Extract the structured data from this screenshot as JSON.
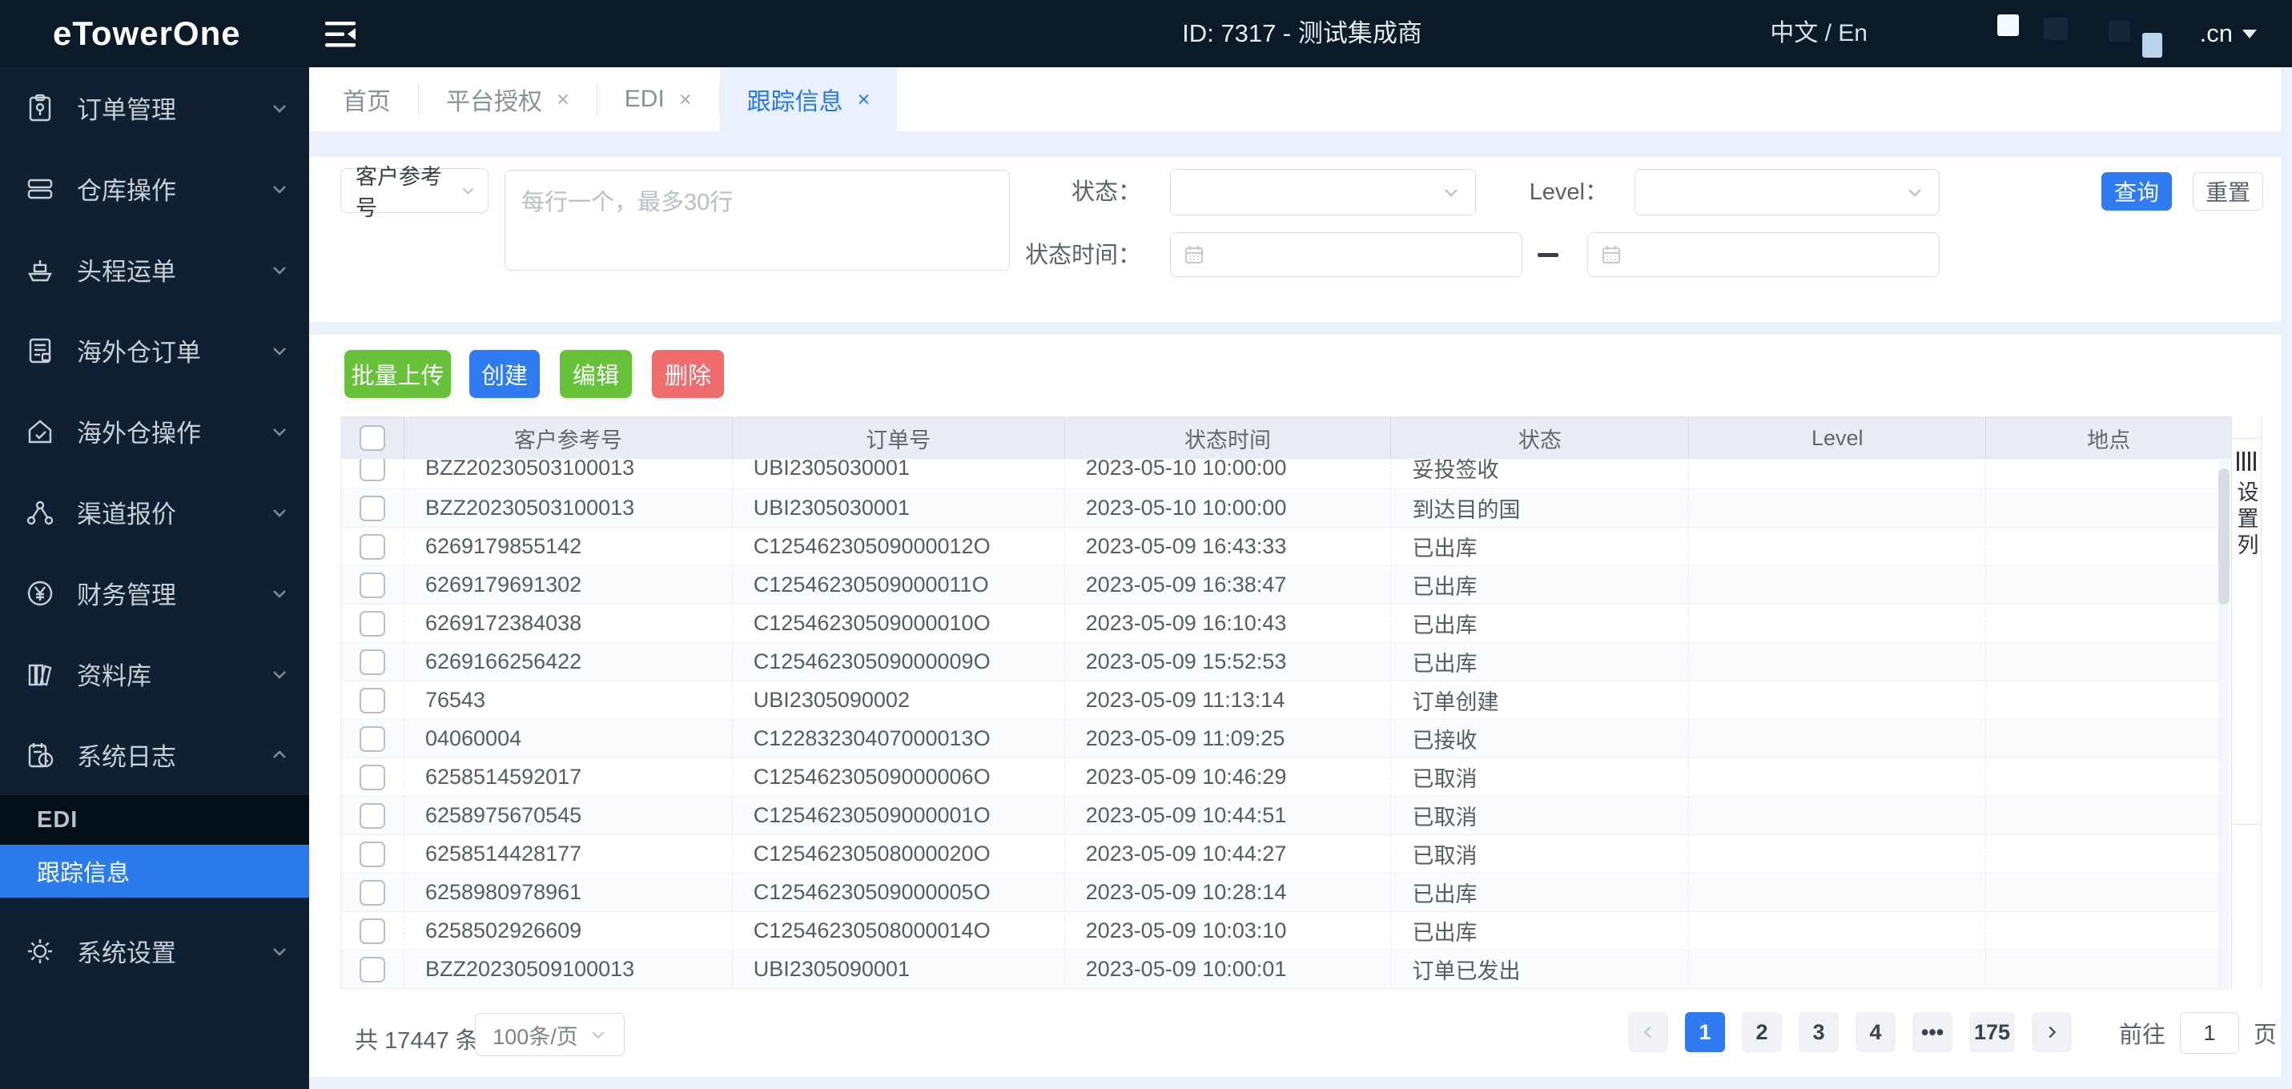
{
  "header": {
    "logo": "eTowerOne",
    "title": "ID: 7317 - 测试集成商",
    "language": "中文 / En",
    "domain": ".cn"
  },
  "sidebar": {
    "items": [
      {
        "label": "订单管理",
        "icon": "clipboard-icon"
      },
      {
        "label": "仓库操作",
        "icon": "boxes-icon"
      },
      {
        "label": "头程运单",
        "icon": "ship-icon"
      },
      {
        "label": "海外仓订单",
        "icon": "document-icon"
      },
      {
        "label": "海外仓操作",
        "icon": "house-check-icon"
      },
      {
        "label": "渠道报价",
        "icon": "share-nodes-icon"
      },
      {
        "label": "财务管理",
        "icon": "yen-circle-icon"
      },
      {
        "label": "资料库",
        "icon": "library-icon"
      },
      {
        "label": "系统日志",
        "icon": "clipboard-clock-icon",
        "expanded": true
      },
      {
        "label": "系统设置",
        "icon": "gear-icon"
      }
    ],
    "submenu": {
      "edi": "EDI",
      "tracking": "跟踪信息"
    }
  },
  "tabs": {
    "home": "首页",
    "platform": "平台授权",
    "edi": "EDI",
    "tracking": "跟踪信息",
    "close_glyph": "×"
  },
  "filters": {
    "field_select_value": "客户参考号",
    "textarea_placeholder": "每行一个，最多30行",
    "status_label": "状态：",
    "level_label": "Level：",
    "time_label": "状态时间：",
    "query_button": "查询",
    "reset_button": "重置"
  },
  "toolbar": {
    "bulk_upload": "批量上传",
    "create": "创建",
    "edit": "编辑",
    "delete": "删除"
  },
  "table": {
    "columns": [
      "客户参考号",
      "订单号",
      "状态时间",
      "状态",
      "Level",
      "地点"
    ],
    "settings_label": "设置列",
    "rows": [
      {
        "ref": "BZZ20230503100013",
        "order": "UBI2305030001",
        "time": "2023-05-10 10:00:00",
        "status": "妥投签收",
        "level": "",
        "location": ""
      },
      {
        "ref": "BZZ20230503100013",
        "order": "UBI2305030001",
        "time": "2023-05-10 10:00:00",
        "status": "到达目的国",
        "level": "",
        "location": ""
      },
      {
        "ref": "6269179855142",
        "order": "C12546230509000012O",
        "time": "2023-05-09 16:43:33",
        "status": "已出库",
        "level": "",
        "location": ""
      },
      {
        "ref": "6269179691302",
        "order": "C12546230509000011O",
        "time": "2023-05-09 16:38:47",
        "status": "已出库",
        "level": "",
        "location": ""
      },
      {
        "ref": "6269172384038",
        "order": "C12546230509000010O",
        "time": "2023-05-09 16:10:43",
        "status": "已出库",
        "level": "",
        "location": ""
      },
      {
        "ref": "6269166256422",
        "order": "C12546230509000009O",
        "time": "2023-05-09 15:52:53",
        "status": "已出库",
        "level": "",
        "location": ""
      },
      {
        "ref": "76543",
        "order": "UBI2305090002",
        "time": "2023-05-09 11:13:14",
        "status": "订单创建",
        "level": "",
        "location": ""
      },
      {
        "ref": "04060004",
        "order": "C12283230407000013O",
        "time": "2023-05-09 11:09:25",
        "status": "已接收",
        "level": "",
        "location": ""
      },
      {
        "ref": "6258514592017",
        "order": "C12546230509000006O",
        "time": "2023-05-09 10:46:29",
        "status": "已取消",
        "level": "",
        "location": ""
      },
      {
        "ref": "6258975670545",
        "order": "C12546230509000001O",
        "time": "2023-05-09 10:44:51",
        "status": "已取消",
        "level": "",
        "location": ""
      },
      {
        "ref": "6258514428177",
        "order": "C12546230508000020O",
        "time": "2023-05-09 10:44:27",
        "status": "已取消",
        "level": "",
        "location": ""
      },
      {
        "ref": "6258980978961",
        "order": "C12546230509000005O",
        "time": "2023-05-09 10:28:14",
        "status": "已出库",
        "level": "",
        "location": ""
      },
      {
        "ref": "6258502926609",
        "order": "C12546230508000014O",
        "time": "2023-05-09 10:03:10",
        "status": "已出库",
        "level": "",
        "location": ""
      },
      {
        "ref": "BZZ20230509100013",
        "order": "UBI2305090001",
        "time": "2023-05-09 10:00:01",
        "status": "订单已发出",
        "level": "",
        "location": ""
      }
    ]
  },
  "pagination": {
    "total": "共 17447 条",
    "page_size": "100条/页",
    "pages": [
      "1",
      "2",
      "3",
      "4",
      "•••",
      "175"
    ],
    "current_page": "1",
    "goto_label": "前往",
    "goto_value": "1",
    "page_suffix": "页"
  },
  "colors": {
    "sidebar_bg": "#0e2031",
    "header_bg": "#0a1a29",
    "accent_blue": "#2e7cf0",
    "selected_menu_blue": "#2a7ced",
    "success_green": "#67c23a",
    "danger_red": "#f16c6c",
    "active_tab_bg": "#e8f1fd",
    "page_bg": "#ecf2fb",
    "table_header_bg": "#e9edf3"
  }
}
